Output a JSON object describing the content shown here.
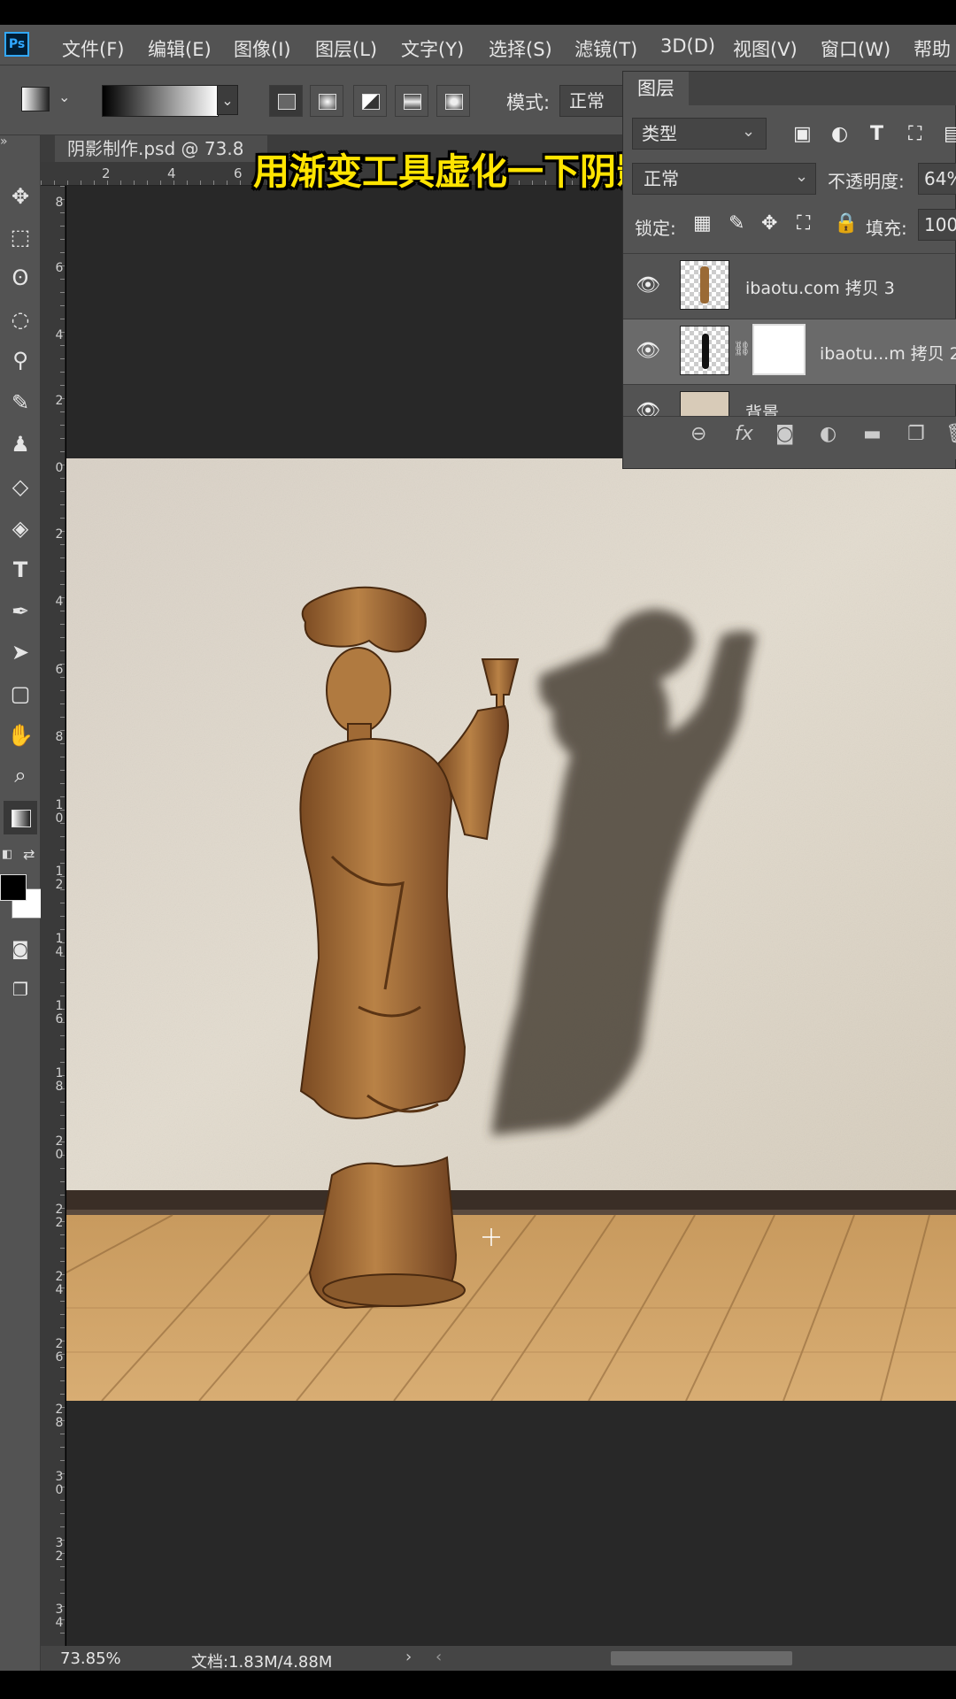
{
  "app": {
    "logo": "Ps"
  },
  "menu": [
    "文件(F)",
    "编辑(E)",
    "图像(I)",
    "图层(L)",
    "文字(Y)",
    "选择(S)",
    "滤镜(T)",
    "3D(D)",
    "视图(V)",
    "窗口(W)",
    "帮助"
  ],
  "options": {
    "mode_label": "模式:",
    "mode_value": "正常"
  },
  "document": {
    "tab_title": "阴影制作.psd @ 73.8",
    "zoom": "73.85%",
    "doc_size": "文档:1.83M/4.88M"
  },
  "ruler": {
    "top": [
      "2",
      "4",
      "6"
    ],
    "left": [
      [
        "8"
      ],
      [
        "6"
      ],
      [
        "4"
      ],
      [
        "2"
      ],
      [
        "0"
      ],
      [
        "2"
      ],
      [
        "4"
      ],
      [
        "6"
      ],
      [
        "8"
      ],
      [
        "1",
        "0"
      ],
      [
        "1",
        "2"
      ],
      [
        "1",
        "4"
      ],
      [
        "1",
        "6"
      ],
      [
        "1",
        "8"
      ],
      [
        "2",
        "0"
      ],
      [
        "2",
        "2"
      ],
      [
        "2",
        "4"
      ],
      [
        "2",
        "6"
      ],
      [
        "2",
        "8"
      ],
      [
        "3",
        "0"
      ],
      [
        "3",
        "2"
      ],
      [
        "3",
        "4"
      ]
    ]
  },
  "layers_panel": {
    "tab": "图层",
    "filter": "类型",
    "blend_mode": "正常",
    "opacity_label": "不透明度:",
    "opacity_value": "64%",
    "lock_label": "锁定:",
    "fill_label": "填充:",
    "fill_value": "100",
    "layers": [
      {
        "name": "ibaotu.com 拷贝 3"
      },
      {
        "name": "ibaotu...m 拷贝 2"
      },
      {
        "name": "背景"
      }
    ]
  },
  "subtitle": "用渐变工具虚化一下阴影",
  "colors": {
    "accent": "#31a8ff",
    "subtitle": "#ffe400",
    "panel": "#535353",
    "pasteboard": "#282828"
  },
  "icons": {
    "tools": [
      "move-icon",
      "marquee-icon",
      "lasso-icon",
      "quick-select-icon",
      "eyedropper-icon",
      "brush-icon",
      "stamp-icon",
      "eraser-icon",
      "paint-bucket-icon",
      "type-icon",
      "pen-icon",
      "path-select-icon",
      "shape-icon",
      "hand-icon",
      "zoom-icon",
      "gradient-icon"
    ]
  }
}
